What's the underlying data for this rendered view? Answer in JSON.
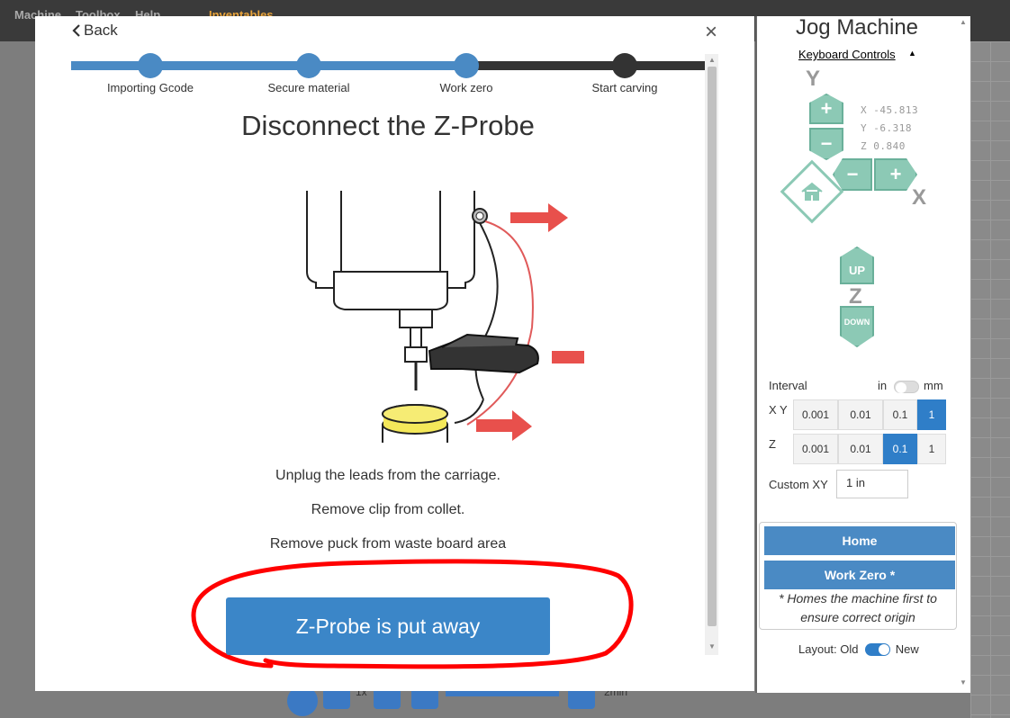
{
  "menubar": {
    "items": [
      "Machine",
      "Toolbox",
      "Help"
    ],
    "brand": "Inventables"
  },
  "modal": {
    "back_label": "Back",
    "close_label": "×",
    "steps": [
      {
        "label": "Importing Gcode",
        "state": "done"
      },
      {
        "label": "Secure material",
        "state": "done"
      },
      {
        "label": "Work zero",
        "state": "current"
      },
      {
        "label": "Start carving",
        "state": "todo"
      }
    ],
    "title": "Disconnect the Z-Probe",
    "instructions": [
      "Unplug the leads from the carriage.",
      "Remove clip from collet.",
      "Remove puck from waste board area"
    ],
    "primary_button": "Z-Probe is put away"
  },
  "jog": {
    "title": "Jog Machine",
    "keyboard_controls": "Keyboard Controls",
    "axis_y": "Y",
    "axis_x": "X",
    "axis_z": "Z",
    "coords": {
      "x": "X -45.813",
      "y": "Y -6.318",
      "z": "Z  0.840"
    },
    "up_label": "UP",
    "down_label": "DOWN",
    "interval_label": "Interval",
    "unit_in": "in",
    "unit_mm": "mm",
    "xy_label": "X Y",
    "z_label": "Z",
    "xy_options": [
      "0.001",
      "0.01",
      "0.1",
      "1"
    ],
    "xy_selected": "1",
    "z_options": [
      "0.001",
      "0.01",
      "0.1",
      "1"
    ],
    "z_selected": "0.1",
    "custom_xy_label": "Custom XY",
    "custom_xy_value": "1 in",
    "home_button": "Home",
    "work_zero_button": "Work Zero *",
    "work_zero_note": "* Homes the machine first to ensure correct origin",
    "layout_label": "Layout: Old",
    "layout_new": "New"
  },
  "bottom": {
    "speed": "1x",
    "time": "2min"
  },
  "colors": {
    "accent": "#3b86c8",
    "jog_green": "#8cc9b5",
    "annotation_red": "#ff0000"
  }
}
